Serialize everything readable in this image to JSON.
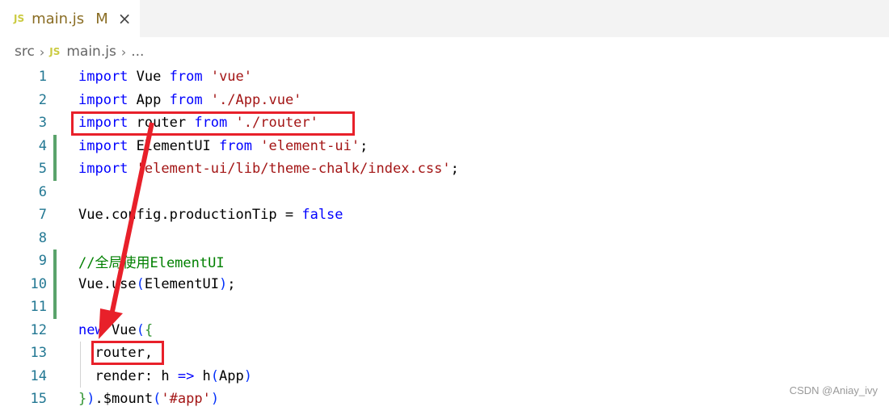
{
  "tab": {
    "icon": "JS",
    "filename": "main.js",
    "status": "M",
    "close": "×"
  },
  "breadcrumb": {
    "folder": "src",
    "icon": "JS",
    "file": "main.js",
    "more": "..."
  },
  "code": [
    {
      "n": "1",
      "tokens": [
        [
          "kw",
          "import"
        ],
        [
          "",
          "Vue "
        ],
        [
          "kw",
          "from"
        ],
        [
          "",
          " "
        ],
        [
          "str",
          "'vue'"
        ]
      ]
    },
    {
      "n": "2",
      "tokens": [
        [
          "kw",
          "import"
        ],
        [
          "",
          "App "
        ],
        [
          "kw",
          "from"
        ],
        [
          "",
          " "
        ],
        [
          "str",
          "'./App.vue'"
        ]
      ]
    },
    {
      "n": "3",
      "tokens": [
        [
          "kw",
          "import"
        ],
        [
          "",
          "router "
        ],
        [
          "kw",
          "from"
        ],
        [
          "",
          " "
        ],
        [
          "str",
          "'./router'"
        ]
      ]
    },
    {
      "n": "4",
      "tokens": [
        [
          "kw",
          "import"
        ],
        [
          "",
          "ElementUI "
        ],
        [
          "kw",
          "from"
        ],
        [
          "",
          " "
        ],
        [
          "str",
          "'element-ui'"
        ],
        [
          "",
          ";"
        ]
      ]
    },
    {
      "n": "5",
      "tokens": [
        [
          "kw",
          "import"
        ],
        [
          "str",
          "'element-ui/lib/theme-chalk/index.css'"
        ],
        [
          "",
          ";"
        ]
      ]
    },
    {
      "n": "6",
      "tokens": []
    },
    {
      "n": "7",
      "tokens": [
        [
          "",
          "Vue.config.productionTip = "
        ],
        [
          "kw",
          "false"
        ]
      ]
    },
    {
      "n": "8",
      "tokens": []
    },
    {
      "n": "9",
      "tokens": [
        [
          "cmt",
          "//全局使用ElementUI"
        ]
      ]
    },
    {
      "n": "10",
      "tokens": [
        [
          "",
          "Vue.use"
        ],
        [
          "br1",
          "("
        ],
        [
          "",
          "ElementUI"
        ],
        [
          "br1",
          ")"
        ],
        [
          "",
          ";"
        ]
      ]
    },
    {
      "n": "11",
      "tokens": []
    },
    {
      "n": "12",
      "tokens": [
        [
          "kw",
          "new"
        ],
        [
          "",
          ""
        ],
        [
          "",
          "Vue"
        ],
        [
          "br1",
          "("
        ],
        [
          "br2",
          "{"
        ]
      ]
    },
    {
      "n": "13",
      "tokens": [
        [
          "",
          "  router,"
        ]
      ]
    },
    {
      "n": "14",
      "tokens": [
        [
          "",
          "  render: h "
        ],
        [
          "kw",
          "=>"
        ],
        [
          "",
          " h"
        ],
        [
          "br1",
          "("
        ],
        [
          "",
          "App"
        ],
        [
          "br1",
          ")"
        ]
      ]
    },
    {
      "n": "15",
      "tokens": [
        [
          "br2",
          "}"
        ],
        [
          "br1",
          ")"
        ],
        [
          "",
          ".$mount"
        ],
        [
          "br1",
          "("
        ],
        [
          "str",
          "'#app'"
        ],
        [
          "br1",
          ")"
        ]
      ]
    }
  ],
  "modified_lines": [
    "4",
    "5",
    "9",
    "10",
    "11"
  ],
  "annotation": {
    "color": "#e8202a",
    "boxes": [
      "import router from './router'",
      "router,"
    ]
  },
  "watermark": "CSDN @Aniay_ivy"
}
